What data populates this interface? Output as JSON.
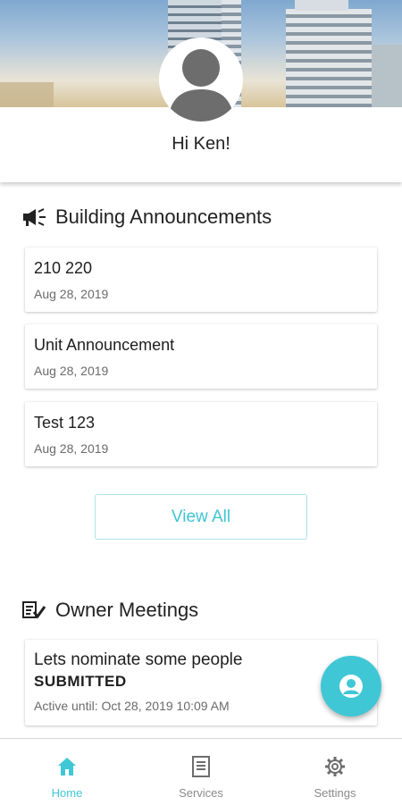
{
  "profile": {
    "greeting": "Hi Ken!"
  },
  "announcements": {
    "title": "Building Announcements",
    "items": [
      {
        "title": "210 220",
        "date": "Aug 28, 2019"
      },
      {
        "title": "Unit Announcement",
        "date": "Aug 28, 2019"
      },
      {
        "title": "Test 123",
        "date": "Aug 28, 2019"
      }
    ],
    "view_all_label": "View All"
  },
  "meetings": {
    "title": "Owner Meetings",
    "items": [
      {
        "title": "Lets nominate some people",
        "status": "SUBMITTED",
        "active_until": "Active until: Oct 28, 2019 10:09 AM"
      }
    ]
  },
  "tabs": [
    {
      "label": "Home",
      "icon": "home-icon",
      "active": true
    },
    {
      "label": "Services",
      "icon": "document-icon",
      "active": false
    },
    {
      "label": "Settings",
      "icon": "gear-icon",
      "active": false
    }
  ],
  "colors": {
    "accent": "#40c7d5",
    "text": "#1e1e1e",
    "muted": "#6a6a6a"
  }
}
